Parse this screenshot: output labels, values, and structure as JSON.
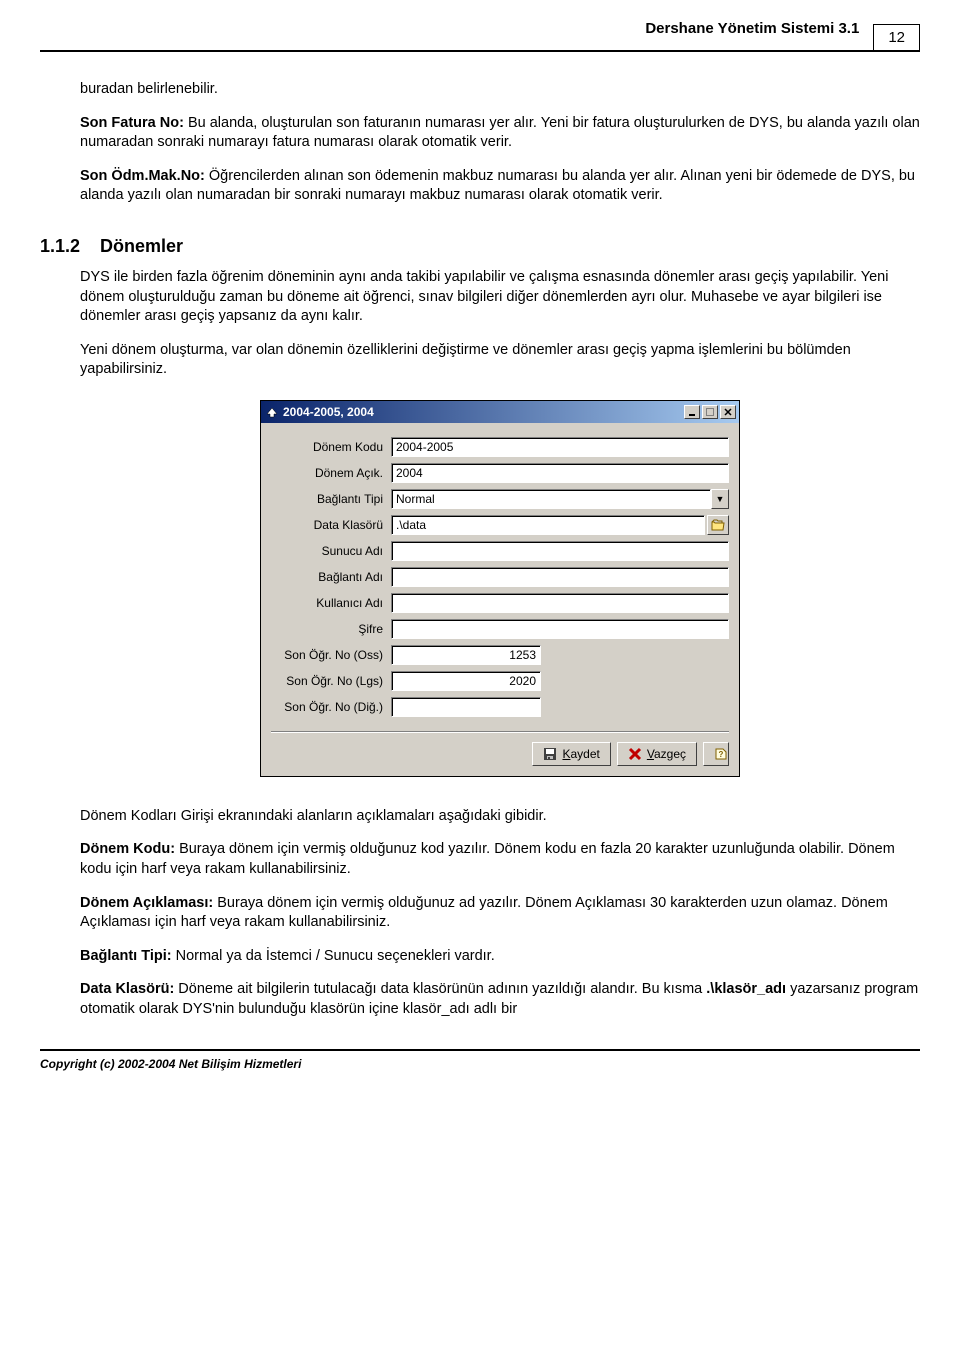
{
  "header": {
    "title": "Dershane Yönetim Sistemi 3.1",
    "page_number": "12"
  },
  "paragraphs": {
    "p1": "buradan belirlenebilir.",
    "p2_label": "Son Fatura No:",
    "p2_text": " Bu alanda, oluşturulan son faturanın numarası yer alır. Yeni bir fatura oluşturulurken de DYS, bu alanda yazılı olan numaradan sonraki numarayı fatura numarası olarak otomatik verir.",
    "p3_label": "Son Ödm.Mak.No:",
    "p3_text": " Öğrencilerden alınan son ödemenin makbuz numarası bu alanda yer alır. Alınan yeni bir ödemede de DYS, bu alanda yazılı olan numaradan bir sonraki numarayı makbuz numarası olarak otomatik verir."
  },
  "section": {
    "number": "1.1.2",
    "title": "Dönemler",
    "p1": "DYS ile birden fazla öğrenim döneminin aynı anda takibi yapılabilir ve çalışma esnasında dönemler arası geçiş yapılabilir. Yeni dönem oluşturulduğu zaman bu döneme ait öğrenci, sınav bilgileri diğer dönemlerden ayrı olur. Muhasebe ve ayar bilgileri ise dönemler arası geçiş yapsanız da aynı kalır.",
    "p2": "Yeni dönem oluşturma, var olan dönemin özelliklerini değiştirme ve dönemler arası geçiş yapma işlemlerini bu bölümden yapabilirsiniz."
  },
  "dialog": {
    "title": "2004-2005, 2004",
    "labels": {
      "donem_kodu": "Dönem Kodu",
      "donem_acik": "Dönem Açık.",
      "baglanti_tipi": "Bağlantı Tipi",
      "data_klasoru": "Data Klasörü",
      "sunucu_adi": "Sunucu Adı",
      "baglanti_adi": "Bağlantı Adı",
      "kullanici_adi": "Kullanıcı Adı",
      "sifre": "Şifre",
      "son_ogr_oss": "Son Öğr. No (Oss)",
      "son_ogr_lgs": "Son Öğr. No (Lgs)",
      "son_ogr_dig": "Son Öğr. No (Diğ.)"
    },
    "values": {
      "donem_kodu": "2004-2005",
      "donem_acik": "2004",
      "baglanti_tipi": "Normal",
      "data_klasoru": ".\\data",
      "sunucu_adi": "",
      "baglanti_adi": "",
      "kullanici_adi": "",
      "sifre": "",
      "son_ogr_oss": "1253",
      "son_ogr_lgs": "2020",
      "son_ogr_dig": ""
    },
    "buttons": {
      "kaydet_prefix": "K",
      "kaydet_rest": "aydet",
      "vazgec_prefix": "V",
      "vazgec_rest": "azgeç"
    }
  },
  "after": {
    "p1": "Dönem Kodları Girişi  ekranındaki alanların açıklamaları aşağıdaki gibidir.",
    "p2_label": "Dönem Kodu:",
    "p2_text": " Buraya dönem için vermiş olduğunuz kod yazılır. Dönem kodu en fazla 20 karakter uzunluğunda olabilir. Dönem kodu için harf veya rakam kullanabilirsiniz.",
    "p3_label": "Dönem Açıklaması:",
    "p3_text": " Buraya dönem için vermiş olduğunuz ad yazılır. Dönem Açıklaması 30 karakterden uzun olamaz. Dönem Açıklaması için harf veya rakam kullanabilirsiniz.",
    "p4_label": "Bağlantı Tipi:",
    "p4_text": " Normal ya da İstemci / Sunucu seçenekleri vardır.",
    "p5_label": "Data Klasörü:",
    "p5_text1": " Döneme ait bilgilerin tutulacağı data klasörünün adının yazıldığı alandır. Bu kısma ",
    "p5_bold": ".\\klasör_adı",
    "p5_text2": " yazarsanız program otomatik olarak DYS'nin bulunduğu klasörün içine klasör_adı adlı bir"
  },
  "footer": "Copyright (c) 2002-2004 Net Bilişim Hizmetleri"
}
